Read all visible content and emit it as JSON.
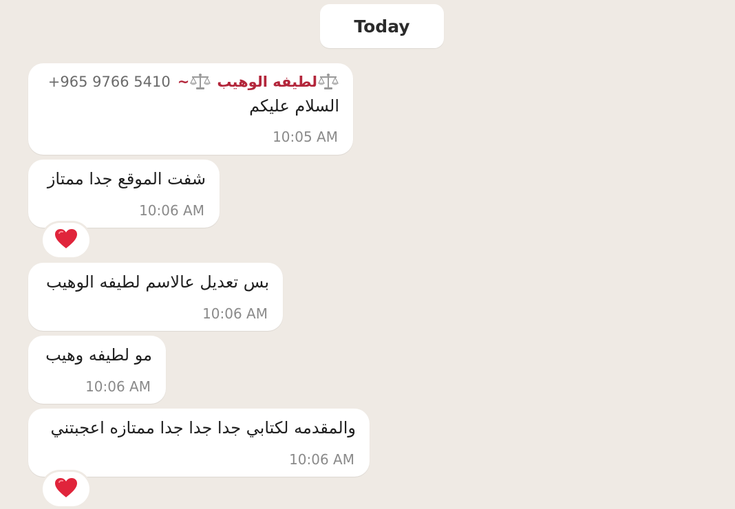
{
  "day_separator": "Today",
  "colors": {
    "background": "#efeae4",
    "bubble": "#ffffff",
    "sender_name": "#b3263b",
    "reaction_heart": "#e0243b"
  },
  "messages": [
    {
      "sender": {
        "phone": "+965 9766 5410",
        "tilde": "~",
        "name": "لطيفه الوهيب",
        "decoration_icon": "balance-scale-icon"
      },
      "text": "السلام عليكم",
      "time": "10:05 AM"
    },
    {
      "text": "شفت الموقع جدا ممتاز",
      "time": "10:06 AM",
      "reaction": "heart-icon"
    },
    {
      "text": "بس تعديل عالاسم لطيفه الوهيب",
      "time": "10:06 AM"
    },
    {
      "text": "مو لطيفه وهيب",
      "time": "10:06 AM"
    },
    {
      "text": "والمقدمه لكتابي جدا جدا جدا ممتازه اعجبتني",
      "time": "10:06 AM",
      "reaction": "heart-icon"
    }
  ]
}
